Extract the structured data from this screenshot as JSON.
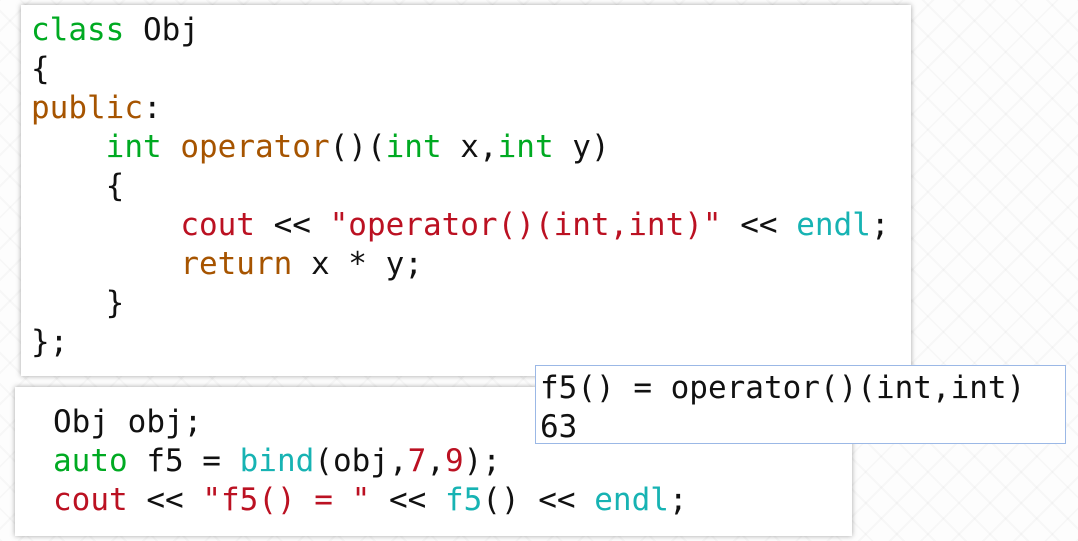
{
  "class_code": {
    "l1": {
      "kw": "class",
      "name": " Obj"
    },
    "l2": {
      "text": "{"
    },
    "l3": {
      "kw": "public",
      "punct": ":"
    },
    "l4": {
      "indent": "    ",
      "ret": "int",
      "sp": " ",
      "op": "operator",
      "paren": "()(",
      "t1": "int",
      "a1": " x,",
      "t2": "int",
      "a2": " y)"
    },
    "l5": {
      "text": "    {"
    },
    "l6": {
      "indent": "        ",
      "cout": "cout",
      "s1": " << ",
      "str": "\"operator()(int,int)\"",
      "s2": " << ",
      "endl": "endl",
      "end": ";"
    },
    "l7": {
      "indent": "        ",
      "ret": "return",
      "expr": " x * y;"
    },
    "l8": {
      "text": "    }"
    },
    "l9": {
      "text": "};"
    }
  },
  "usage_code": {
    "l1": {
      "text": "Obj obj;"
    },
    "l2": {
      "kw": "auto",
      "a": " f5 = ",
      "bind": "bind",
      "b": "(obj,",
      "n1": "7",
      "c": ",",
      "n2": "9",
      "d": ");"
    },
    "l3": {
      "cout": "cout",
      "s1": " << ",
      "str": "\"f5() = \"",
      "s2": " << ",
      "f5": "f5",
      "p": "()",
      "s3": " << ",
      "endl": "endl",
      "end": ";"
    }
  },
  "output": {
    "line1": "f5() = operator()(int,int)",
    "line2": "63"
  },
  "colors": {
    "keyword": "#00aa22",
    "access": "#a65400",
    "string": "#bb1122",
    "library": "#17b3b3",
    "text": "#111111"
  }
}
